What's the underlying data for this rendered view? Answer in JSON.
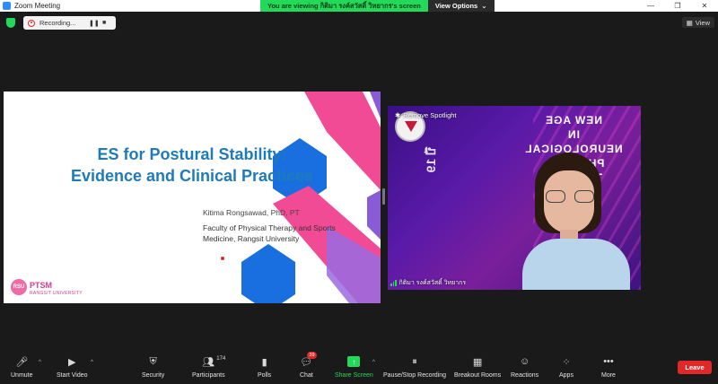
{
  "window": {
    "title": "Zoom Meeting",
    "minimize_icon": "—",
    "maximize_icon": "❐",
    "close_icon": "✕"
  },
  "share_banner": {
    "viewing_text": "You are viewing กิติมา รงค์สวัสดิ์ วิทยากร's screen",
    "view_options_label": "View Options",
    "caret": "⌄"
  },
  "recording": {
    "label": "Recording...",
    "pause_icon": "❚❚",
    "stop_icon": "■"
  },
  "view_button": {
    "label": "View",
    "icon": "▦"
  },
  "slide": {
    "title_line1": "ES for Postural Stability:",
    "title_line2": "Evidence and Clinical Practices",
    "author": "Kitima Rongsawad, PhD, PT",
    "affiliation_line1": "Faculty of Physical Therapy and Sports",
    "affiliation_line2": "Medicine, Rangsit University",
    "logo_circle": "RSU",
    "logo_text": "PTSM",
    "logo_subtext": "RANGSIT UNIVERSITY",
    "colors": {
      "pink": "#f24b95",
      "blue": "#1a6fe0",
      "purple": "#8a5bd6",
      "title": "#1f7ab8"
    }
  },
  "video": {
    "spotlight_label": "Remove Spotlight",
    "spotlight_icon": "✱",
    "mirror_text_line1": "NEW AGE",
    "mirror_text_line2": "IN NEUROLOGICAL",
    "mirror_text_line3": "PHYSICAL THERAPY",
    "side_text": "ปี 19",
    "participant_name": "กิติมา รงค์สวัสดิ์ วิทยากร"
  },
  "toolbar": {
    "unmute": {
      "label": "Unmute",
      "icon": "🎤︎"
    },
    "start_video": {
      "label": "Start Video",
      "icon": "▶"
    },
    "security": {
      "label": "Security",
      "icon": "⛨"
    },
    "participants": {
      "label": "Participants",
      "icon": "👥︎",
      "count": "174"
    },
    "polls": {
      "label": "Polls",
      "icon": "▮"
    },
    "chat": {
      "label": "Chat",
      "icon": "💬︎",
      "badge": "39"
    },
    "share_screen": {
      "label": "Share Screen",
      "icon": "↑"
    },
    "pause_recording": {
      "label": "Pause/Stop Recording",
      "icon": "⏸︎"
    },
    "breakout_rooms": {
      "label": "Breakout Rooms",
      "icon": "▦"
    },
    "reactions": {
      "label": "Reactions",
      "icon": "☺"
    },
    "apps": {
      "label": "Apps",
      "icon": "⁘"
    },
    "more": {
      "label": "More",
      "icon": "•••"
    },
    "caret": "^",
    "leave_label": "Leave"
  }
}
